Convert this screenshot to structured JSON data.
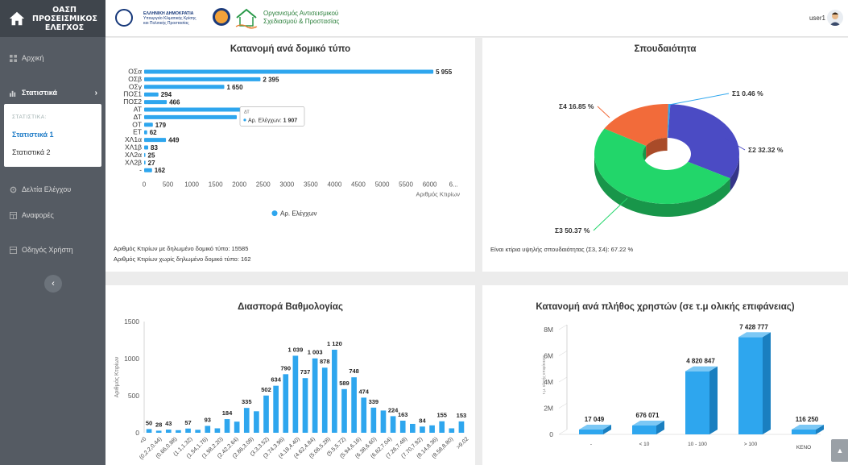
{
  "brand": {
    "line1": "ΟΑΣΠ",
    "line2": "ΠΡΟΣΕΙΣΜΙΚΟΣ",
    "line3": "ΕΛΕΓΧΟΣ"
  },
  "topbar": {
    "ministry_l1": "ΕΛΛΗΝΙΚΗ ΔΗΜΟΚΡΑΤΙΑ",
    "ministry_l2": "Υπουργείο Κλιματικής Κρίσης",
    "ministry_l3": "και Πολιτικής Προστασίας",
    "oasp_small": "ΟΑΣΠ",
    "org_l1": "Οργανισμός Αντισεισμικού",
    "org_l2": "Σχεδιασμού & Προστασίας",
    "user": "user1"
  },
  "nav": {
    "home": "Αρχική",
    "stats": "Στατιστικά",
    "stats_chevron": "›",
    "submenu_header": "ΣΤΑΤΙΣΤΙΚΑ:",
    "stats1": "Στατιστικά 1",
    "stats2": "Στατιστικά 2",
    "reports_ctrl": "Δελτία Ελέγχου",
    "reports": "Αναφορές",
    "guide": "Οδηγός Χρήστη",
    "collapse": "‹"
  },
  "cards": {
    "structural": {
      "title": "Κατανομή ανά δομικό τύπο",
      "footer1": "Αριθμός Κτιρίων με δηλωμένο δομικό τύπο: 15585",
      "footer2": "Αριθμός Κτιρίων χωρίς δηλωμένο δομικό τύπο: 162",
      "tooltip_title": "ΔΤ",
      "tooltip_series": "Αρ. Ελέγχων",
      "tooltip_value": "1 907"
    },
    "importance": {
      "title": "Σπουδαιότητα",
      "footer": "Είναι κτίρια υψηλής σπουδαιότητας (Σ3, Σ4): 67.22 %"
    },
    "score": {
      "title": "Διασπορά Βαθμολογίας"
    },
    "users": {
      "title": "Κατανομή ανά πλήθος χρηστών (σε τ.μ ολικής επιφάνειας)"
    }
  },
  "chart_data": [
    {
      "type": "bar",
      "orientation": "horizontal",
      "title": "Κατανομή ανά δομικό τύπο",
      "categories": [
        "ΟΣα",
        "ΟΣβ",
        "ΟΣγ",
        "ΠΟΣ1",
        "ΠΟΣ2",
        "ΑΤ",
        "ΔΤ",
        "ΟΤ",
        "ΕΤ",
        "ΧΛ1α",
        "ΧΛ1β",
        "ΧΛ2α",
        "ΧΛ2β",
        "-"
      ],
      "values": [
        5955,
        2395,
        1650,
        294,
        466,
        2000,
        1907,
        179,
        62,
        449,
        83,
        25,
        27,
        162
      ],
      "labels": [
        "5 955",
        "2 395",
        "1 650",
        "294",
        "466",
        "",
        "",
        "179",
        "62",
        "449",
        "83",
        "25",
        "27",
        "162"
      ],
      "xticks": [
        "0",
        "500",
        "1000",
        "1500",
        "2000",
        "2500",
        "3000",
        "3500",
        "4000",
        "4500",
        "5000",
        "5500",
        "6000",
        "6..."
      ],
      "xlim": [
        0,
        6500
      ],
      "xlabel": "Αριθμός Κτιρίων",
      "legend": "Αρ. Ελέγχων",
      "color": "#2ea6ee"
    },
    {
      "type": "pie",
      "title": "Σπουδαιότητα",
      "slices": [
        {
          "label": "Σ1 0.46 %",
          "value": 0.46,
          "color": "#2ea6ee"
        },
        {
          "label": "Σ2 32.32 %",
          "value": 32.32,
          "color": "#4b4bc4"
        },
        {
          "label": "Σ3 50.37 %",
          "value": 50.37,
          "color": "#22d66a"
        },
        {
          "label": "Σ4 16.85 %",
          "value": 16.85,
          "color": "#f26b3a"
        }
      ]
    },
    {
      "type": "bar",
      "title": "Διασπορά Βαθμολογίας",
      "ylabel": "Αριθμός Κτιρίων",
      "yticks": [
        "0",
        "500",
        "1000",
        "1500"
      ],
      "ylim": [
        0,
        1500
      ],
      "values": [
        50,
        28,
        43,
        35,
        57,
        40,
        93,
        60,
        184,
        150,
        335,
        290,
        502,
        634,
        790,
        1039,
        737,
        1003,
        878,
        1120,
        589,
        748,
        474,
        339,
        300,
        224,
        163,
        120,
        84,
        100,
        155,
        60,
        153
      ],
      "value_labels": {
        "0": "50",
        "1": "28",
        "2": "43",
        "4": "57",
        "6": "93",
        "8": "184",
        "10": "335",
        "12": "502",
        "13": "634",
        "14": "790",
        "15": "1 039",
        "16": "737",
        "17": "1 003",
        "18": "878",
        "19": "1 120",
        "20": "589",
        "21": "748",
        "22": "474",
        "23": "339",
        "25": "224",
        "26": "163",
        "28": "84",
        "30": "155",
        "32": "153"
      },
      "xticks": [
        "<0",
        "(0,2.2,0.44)",
        "(0.66,0.88)",
        "(1.1,1.32)",
        "(1.54,1.76)",
        "(1.98,2.20)",
        "(2.42,2.64)",
        "(2.86,3.08)",
        "(3.3,3.52)",
        "(3.74,3.96)",
        "(4.18,4.40)",
        "(4.62,4.84)",
        "(5.06,5.28)",
        "(5.5,5.72)",
        "(5.94,6.16)",
        "(6.38,6.60)",
        "(6.82,7.04)",
        "(7.26,7.48)",
        "(7.70,7.92)",
        "(8.14,8.36)",
        "(8.58,8.80)",
        ">9.02"
      ],
      "color": "#2ea6ee"
    },
    {
      "type": "bar",
      "style": "3d",
      "title": "Κατανομή ανά πλήθος χρηστών (σε τ.μ ολικής επιφάνειας)",
      "categories": [
        "-",
        "< 10",
        "10 - 100",
        "> 100",
        "ΚΕΝΟ"
      ],
      "values": [
        17049,
        676071,
        4820847,
        7428777,
        116250
      ],
      "labels": [
        "17 049",
        "676 071",
        "4 820 847",
        "7 428 777",
        "116 250"
      ],
      "yticks": [
        "0",
        "2M",
        "4M",
        "6M",
        "8M"
      ],
      "ylim": [
        0,
        8000000
      ],
      "ylabel": "τ.μ. ολικής επιφάνειας",
      "color": "#2ea6ee"
    }
  ]
}
